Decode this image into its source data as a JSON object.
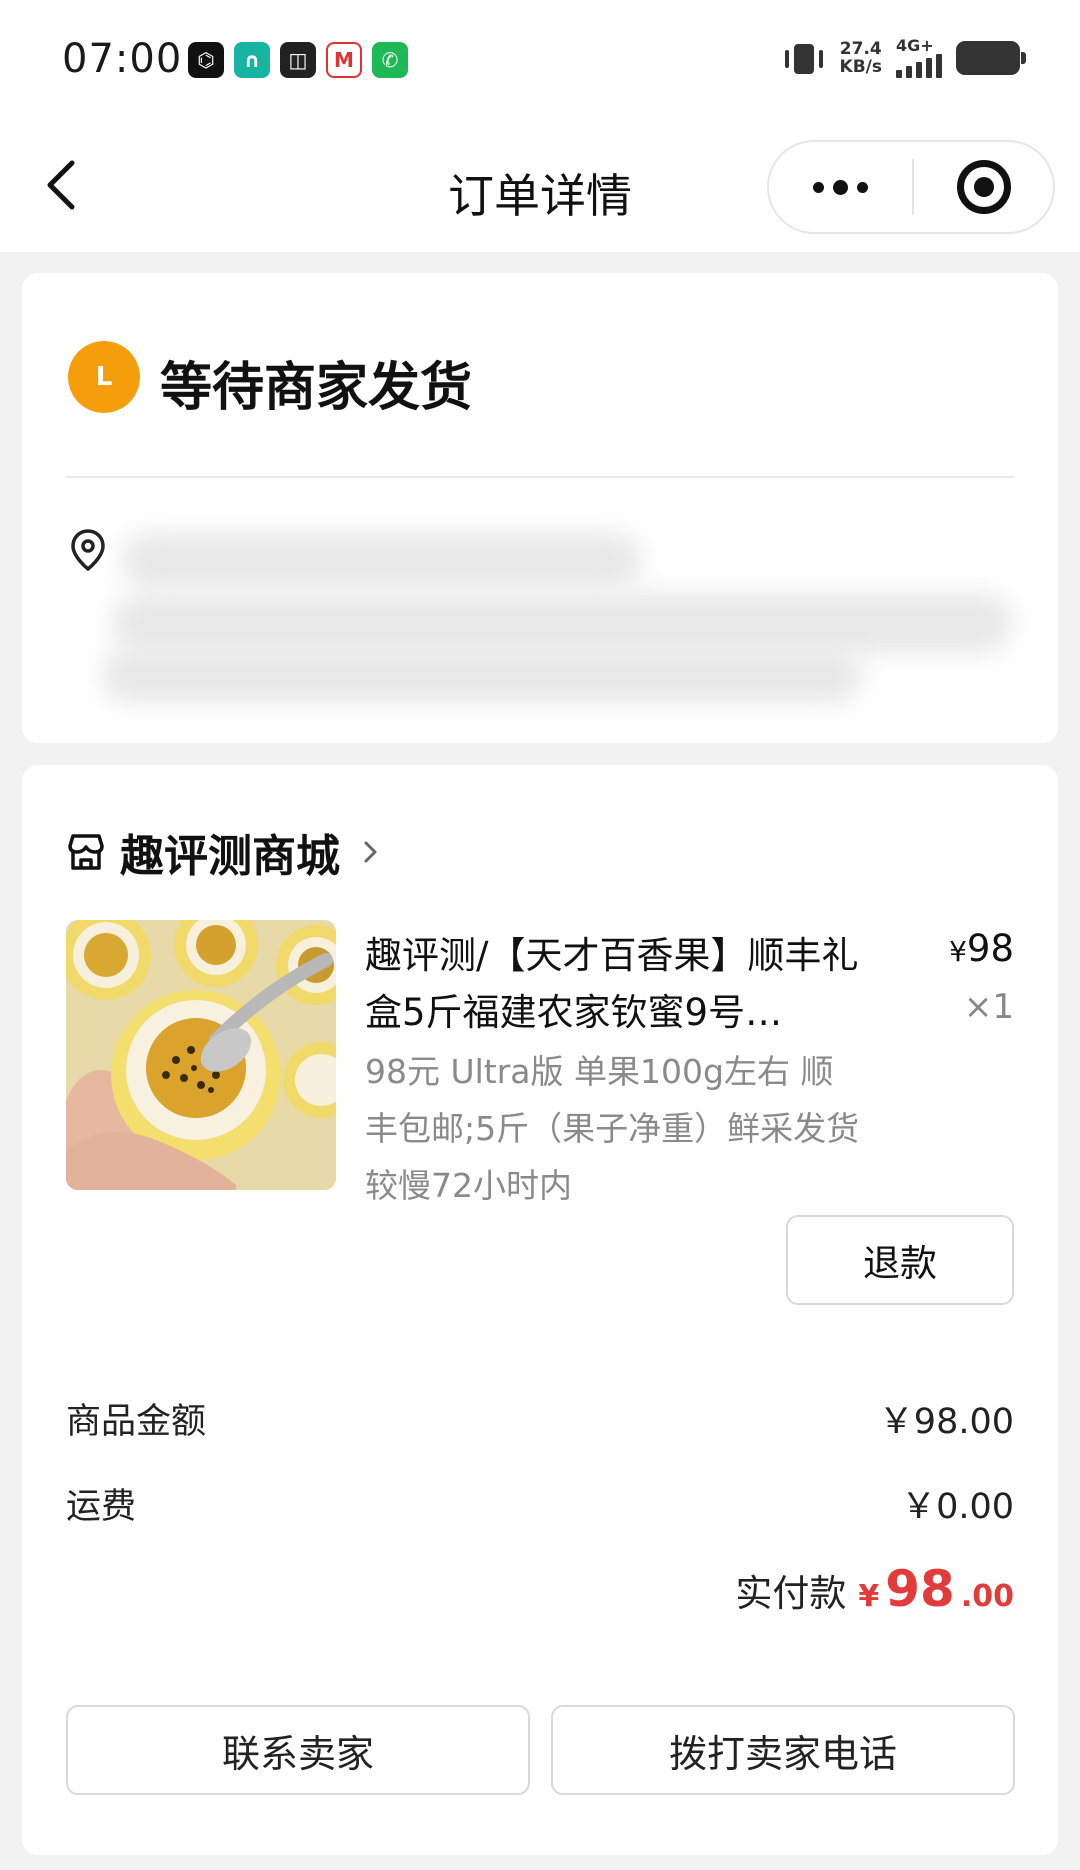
{
  "status_bar": {
    "time": "07:00",
    "net_speed_value": "27.4",
    "net_speed_unit": "KB/s",
    "network_type": "4G+",
    "icons": [
      "notification-app-icon",
      "ring-app-icon",
      "square-app-icon",
      "bank-app-icon",
      "phone-app-icon",
      "vibrate-icon",
      "signal-icon",
      "battery-icon"
    ]
  },
  "nav": {
    "title": "订单详情"
  },
  "order_status": {
    "badge_letter": "L",
    "text": "等待商家发货",
    "badge_color": "#f59e0b"
  },
  "shop": {
    "name": "趣评测商城"
  },
  "product": {
    "title": "趣评测/【天才百香果】顺丰礼盒5斤福建农家钦蜜9号…",
    "price_symbol": "¥",
    "price": "98",
    "quantity": "×1",
    "spec": "98元 Ultra版 单果100g左右 顺丰包邮;5斤（果子净重）鲜采发货较慢72小时内",
    "refund_label": "退款"
  },
  "summary": {
    "goods_label": "商品金额",
    "goods_value": "￥98.00",
    "shipping_label": "运费",
    "shipping_value": "￥0.00",
    "total_label": "实付款",
    "total_symbol": "¥",
    "total_int": "98",
    "total_dec": ".00",
    "accent_color": "#e23b3b"
  },
  "actions": {
    "contact_label": "联系卖家",
    "call_label": "拨打卖家电话"
  }
}
